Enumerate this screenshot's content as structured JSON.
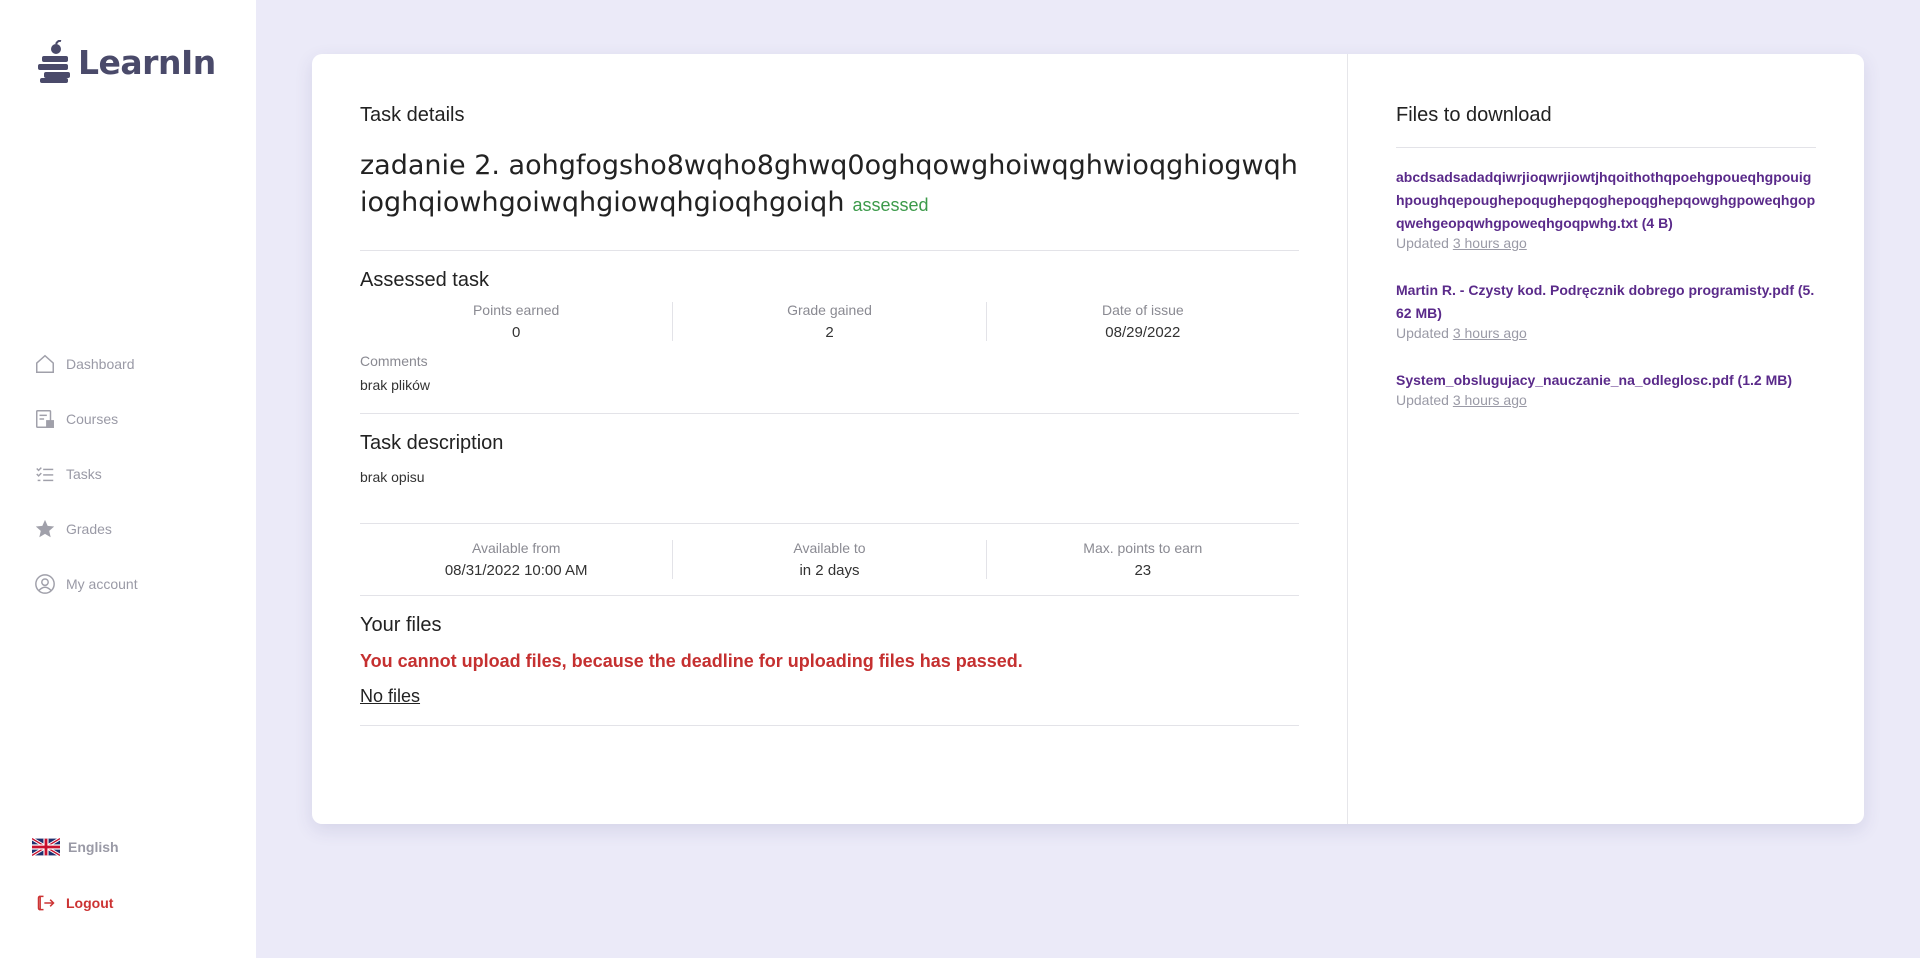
{
  "app": {
    "name": "LearnIn"
  },
  "sidebar": {
    "items": [
      {
        "label": "Dashboard",
        "icon": "home-icon"
      },
      {
        "label": "Courses",
        "icon": "courses-icon"
      },
      {
        "label": "Tasks",
        "icon": "tasks-icon"
      },
      {
        "label": "Grades",
        "icon": "star-icon"
      },
      {
        "label": "My account",
        "icon": "account-icon"
      }
    ],
    "language": "English",
    "logout": "Logout"
  },
  "task": {
    "section_label": "Task details",
    "title": "zadanie 2. aohgfogsho8wqho8ghwq0oghqowghoiwqghwioqghiogwqhioghqiowhgoiwqhgiowqhgioqhgoiqh",
    "status": "assessed",
    "assessed": {
      "heading": "Assessed task",
      "points_label": "Points earned",
      "points_value": "0",
      "grade_label": "Grade gained",
      "grade_value": "2",
      "date_label": "Date of issue",
      "date_value": "08/29/2022",
      "comments_label": "Comments",
      "comments_value": "brak plików"
    },
    "description": {
      "heading": "Task description",
      "text": "brak opisu"
    },
    "availability": {
      "from_label": "Available from",
      "from_value": "08/31/2022 10:00 AM",
      "to_label": "Available to",
      "to_value": "in 2 days",
      "max_label": "Max. points to earn",
      "max_value": "23"
    },
    "your_files": {
      "heading": "Your files",
      "error": "You cannot upload files, because the deadline for uploading files has passed.",
      "empty": "No files"
    }
  },
  "downloads": {
    "heading": "Files to download",
    "updated_prefix": "Updated",
    "files": [
      {
        "name": "abcdsadsadadqiwrjioqwrjiowtjhqoithothqpoehgpoueqhgpouighpoughqepoughepoqughepqoghepoqghepqowghgpoweqhgopqwehgeopqwhgpoweqhgoqpwhg.txt (4 B)",
        "updated": "3 hours ago"
      },
      {
        "name": "Martin R. - Czysty kod. Podręcznik dobrego programisty.pdf (5.62 MB)",
        "updated": "3 hours ago"
      },
      {
        "name": "System_obslugujacy_nauczanie_na_odleglosc.pdf (1.2 MB)",
        "updated": "3 hours ago"
      }
    ]
  },
  "colors": {
    "background": "#ebeaf8",
    "link": "#5a2a8a",
    "status_assessed": "#3c9a4a",
    "error": "#c53030",
    "logout": "#cc3333"
  }
}
